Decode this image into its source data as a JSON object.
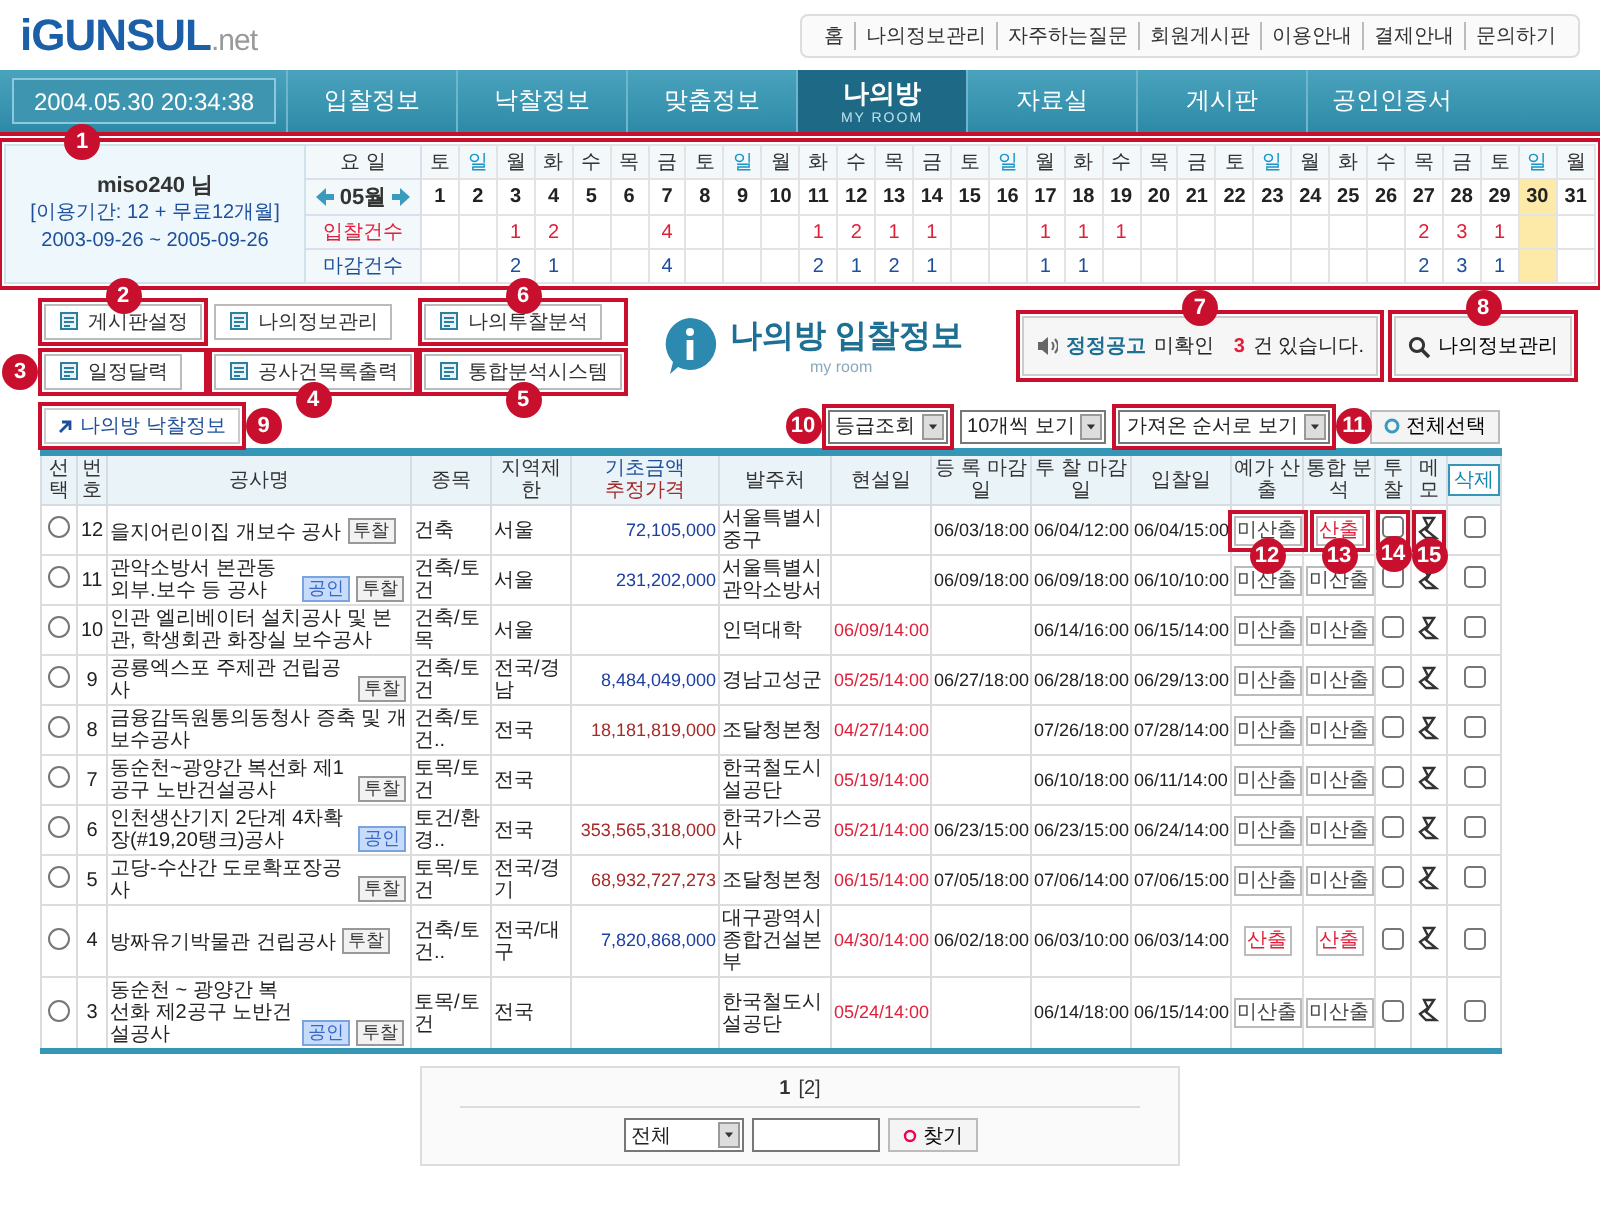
{
  "header": {
    "logo": {
      "main": "iGUNSUL",
      "suffix": ".net"
    },
    "top_links": [
      "홈",
      "나의정보관리",
      "자주하는질문",
      "회원게시판",
      "이용안내",
      "결제안내",
      "문의하기"
    ]
  },
  "nav": {
    "datetime": "2004.05.30 20:34:38",
    "items": [
      {
        "label": "입찰정보",
        "selected": false
      },
      {
        "label": "낙찰정보",
        "selected": false
      },
      {
        "label": "맞춤정보",
        "selected": false
      },
      {
        "label": "나의방",
        "sub": "MY ROOM",
        "selected": true
      },
      {
        "label": "자료실",
        "selected": false
      },
      {
        "label": "게시판",
        "selected": false
      },
      {
        "label": "공인인증서",
        "selected": false
      }
    ]
  },
  "calendar": {
    "callout": "1",
    "user": "miso240 님",
    "period": "[이용기간: 12 + 무료12개월]",
    "range": "2003-09-26 ~ 2005-09-26",
    "weekday_label": "요 일",
    "month": "05월",
    "bids_label": "입찰건수",
    "closes_label": "마감건수",
    "days": [
      {
        "weekday": "토",
        "date": "1",
        "holiday": false,
        "today": false
      },
      {
        "weekday": "일",
        "date": "2",
        "holiday": true,
        "today": false
      },
      {
        "weekday": "월",
        "date": "3",
        "bids": "1",
        "closes": "2",
        "holiday": false,
        "today": false
      },
      {
        "weekday": "화",
        "date": "4",
        "bids": "2",
        "closes": "1",
        "holiday": false,
        "today": false
      },
      {
        "weekday": "수",
        "date": "5",
        "holiday": false,
        "today": false
      },
      {
        "weekday": "목",
        "date": "6",
        "holiday": false,
        "today": false
      },
      {
        "weekday": "금",
        "date": "7",
        "bids": "4",
        "closes": "4",
        "holiday": false,
        "today": false
      },
      {
        "weekday": "토",
        "date": "8",
        "holiday": false,
        "today": false
      },
      {
        "weekday": "일",
        "date": "9",
        "holiday": true,
        "today": false
      },
      {
        "weekday": "월",
        "date": "10",
        "holiday": false,
        "today": false
      },
      {
        "weekday": "화",
        "date": "11",
        "bids": "1",
        "closes": "2",
        "holiday": false,
        "today": false
      },
      {
        "weekday": "수",
        "date": "12",
        "bids": "2",
        "closes": "1",
        "holiday": false,
        "today": false
      },
      {
        "weekday": "목",
        "date": "13",
        "bids": "1",
        "closes": "2",
        "holiday": false,
        "today": false
      },
      {
        "weekday": "금",
        "date": "14",
        "bids": "1",
        "closes": "1",
        "holiday": false,
        "today": false
      },
      {
        "weekday": "토",
        "date": "15",
        "holiday": false,
        "today": false
      },
      {
        "weekday": "일",
        "date": "16",
        "holiday": true,
        "today": false
      },
      {
        "weekday": "월",
        "date": "17",
        "bids": "1",
        "closes": "1",
        "holiday": false,
        "today": false
      },
      {
        "weekday": "화",
        "date": "18",
        "bids": "1",
        "closes": "1",
        "holiday": false,
        "today": false
      },
      {
        "weekday": "수",
        "date": "19",
        "bids": "1",
        "holiday": false,
        "today": false
      },
      {
        "weekday": "목",
        "date": "20",
        "holiday": false,
        "today": false
      },
      {
        "weekday": "금",
        "date": "21",
        "holiday": false,
        "today": false
      },
      {
        "weekday": "토",
        "date": "22",
        "holiday": false,
        "today": false
      },
      {
        "weekday": "일",
        "date": "23",
        "holiday": true,
        "today": false
      },
      {
        "weekday": "월",
        "date": "24",
        "holiday": false,
        "today": false
      },
      {
        "weekday": "화",
        "date": "25",
        "holiday": false,
        "today": false
      },
      {
        "weekday": "수",
        "date": "26",
        "holiday": false,
        "today": false
      },
      {
        "weekday": "목",
        "date": "27",
        "bids": "2",
        "closes": "2",
        "holiday": false,
        "today": false
      },
      {
        "weekday": "금",
        "date": "28",
        "bids": "3",
        "closes": "3",
        "holiday": false,
        "today": false
      },
      {
        "weekday": "토",
        "date": "29",
        "bids": "1",
        "closes": "1",
        "holiday": false,
        "today": false
      },
      {
        "weekday": "일",
        "date": "30",
        "holiday": true,
        "today": true
      },
      {
        "weekday": "월",
        "date": "31",
        "holiday": false,
        "today": false
      }
    ]
  },
  "menu_buttons": [
    {
      "label": "게시판설정",
      "callout": "2"
    },
    {
      "label": "나의정보관리"
    },
    {
      "label": "나의투찰분석",
      "callout": "6"
    },
    {
      "label": "일정달력",
      "callout": "3"
    },
    {
      "label": "공사건목록출력",
      "callout": "4"
    },
    {
      "label": "통합분석시스템",
      "callout": "5"
    }
  ],
  "title": {
    "text": "나의방 입찰정보",
    "sub": "my room"
  },
  "notice": {
    "callout": "7",
    "link": "정정공고",
    "text": "미확인",
    "count": "3",
    "suffix": "건 있습니다."
  },
  "info_button": {
    "label": "나의정보관리",
    "callout": "8"
  },
  "toolbar": {
    "won_link": {
      "label": "나의방 낙찰정보",
      "callout": "9"
    },
    "grade_select": {
      "value": "등급조회",
      "callout": "10"
    },
    "page_size_select": {
      "value": "10개씩 보기"
    },
    "sort_select": {
      "value": "가져온 순서로 보기",
      "callout": "11"
    },
    "select_all": {
      "label": "전체선택"
    }
  },
  "table": {
    "columns": [
      {
        "kind": "text",
        "label": "선택"
      },
      {
        "kind": "text",
        "label": "번호"
      },
      {
        "kind": "text",
        "label": "공사명"
      },
      {
        "kind": "text",
        "label": "종목"
      },
      {
        "kind": "text",
        "label": "지역제한"
      },
      {
        "kind": "amount",
        "label": "기초금액",
        "sub": "추정가격"
      },
      {
        "kind": "text",
        "label": "발주처"
      },
      {
        "kind": "text",
        "label": "현설일"
      },
      {
        "kind": "text",
        "label": "등 록 마감일"
      },
      {
        "kind": "text",
        "label": "투 찰 마감일"
      },
      {
        "kind": "text",
        "label": "입찰일"
      },
      {
        "kind": "text",
        "label": "예가 산출"
      },
      {
        "kind": "text",
        "label": "통합 분석"
      },
      {
        "kind": "text",
        "label": "투 찰"
      },
      {
        "kind": "text",
        "label": "메 모"
      },
      {
        "kind": "button",
        "label": "삭제"
      }
    ],
    "rows": [
      {
        "selected": false,
        "no": "12",
        "name": "을지어린이집 개보수 공사",
        "tags": [
          {
            "kind": "bid",
            "label": "투찰"
          }
        ],
        "category": "건축",
        "region": "서울",
        "amount": {
          "value": "72,105,000",
          "color": "#1d3fa0"
        },
        "agency": "서울특별시중구",
        "reg_deadline": "06/03/18:00",
        "bid_deadline": "06/04/12:00",
        "bid_date": "06/04/15:00",
        "estimate": {
          "label": "미산출",
          "calculated": false
        },
        "analysis": {
          "label": "산출",
          "calculated": true
        },
        "bid_checked": false,
        "delete_checked": false,
        "callouts": {
          "estimate": "12",
          "analysis": "13",
          "bid": "14",
          "memo": "15"
        }
      },
      {
        "selected": false,
        "no": "11",
        "name": "관악소방서 본관동 외부.보수 등 공사",
        "tags": [
          {
            "kind": "cert",
            "label": "공인"
          },
          {
            "kind": "bid",
            "label": "투찰"
          }
        ],
        "category": "건축/토건",
        "region": "서울",
        "amount": {
          "value": "231,202,000",
          "color": "#1d3fa0"
        },
        "agency": "서울특별시관악소방서",
        "reg_deadline": "06/09/18:00",
        "bid_deadline": "06/09/18:00",
        "bid_date": "06/10/10:00",
        "estimate": {
          "label": "미산출",
          "calculated": false
        },
        "analysis": {
          "label": "미산출",
          "calculated": false
        },
        "bid_checked": false,
        "delete_checked": false
      },
      {
        "selected": false,
        "no": "10",
        "name": "인관 엘리베이터 설치공사 및 본관, 학생회관 화장실 보수공사",
        "category": "건축/토목",
        "region": "서울",
        "agency": "인덕대학",
        "site_date": "06/09/14:00",
        "bid_deadline": "06/14/16:00",
        "bid_date": "06/15/14:00",
        "estimate": {
          "label": "미산출",
          "calculated": false
        },
        "analysis": {
          "label": "미산출",
          "calculated": false
        },
        "bid_checked": false,
        "delete_checked": false
      },
      {
        "selected": false,
        "no": "9",
        "name": "공룡엑스포 주제관 건립공사",
        "tags": [
          {
            "kind": "bid",
            "label": "투찰"
          }
        ],
        "category": "건축/토건",
        "region": "전국/경남",
        "amount": {
          "value": "8,484,049,000",
          "color": "#1d3fa0"
        },
        "agency": "경남고성군",
        "site_date": "05/25/14:00",
        "reg_deadline": "06/27/18:00",
        "bid_deadline": "06/28/18:00",
        "bid_date": "06/29/13:00",
        "estimate": {
          "label": "미산출",
          "calculated": false
        },
        "analysis": {
          "label": "미산출",
          "calculated": false
        },
        "bid_checked": false,
        "delete_checked": false
      },
      {
        "selected": false,
        "no": "8",
        "name": "금융감독원통의동청사 증축 및 개보수공사",
        "category": "건축/토건..",
        "region": "전국",
        "amount": {
          "value": "18,181,819,000",
          "color": "#a52a2a"
        },
        "agency": "조달청본청",
        "site_date": "04/27/14:00",
        "bid_deadline": "07/26/18:00",
        "bid_date": "07/28/14:00",
        "estimate": {
          "label": "미산출",
          "calculated": false
        },
        "analysis": {
          "label": "미산출",
          "calculated": false
        },
        "bid_checked": false,
        "delete_checked": false
      },
      {
        "selected": false,
        "no": "7",
        "name": "동순천~광양간 복선화 제1공구 노반건설공사",
        "tags": [
          {
            "kind": "bid",
            "label": "투찰"
          }
        ],
        "category": "토목/토건",
        "region": "전국",
        "agency": "한국철도시설공단",
        "site_date": "05/19/14:00",
        "bid_deadline": "06/10/18:00",
        "bid_date": "06/11/14:00",
        "estimate": {
          "label": "미산출",
          "calculated": false
        },
        "analysis": {
          "label": "미산출",
          "calculated": false
        },
        "bid_checked": false,
        "delete_checked": false
      },
      {
        "selected": false,
        "no": "6",
        "name": "인천생산기지 2단계 4차확장(#19,20탱크)공사",
        "tags": [
          {
            "kind": "cert",
            "label": "공인"
          }
        ],
        "category": "토건/환경..",
        "region": "전국",
        "amount": {
          "value": "353,565,318,000",
          "color": "#a52a2a"
        },
        "agency": "한국가스공사",
        "site_date": "05/21/14:00",
        "reg_deadline": "06/23/15:00",
        "bid_deadline": "06/23/15:00",
        "bid_date": "06/24/14:00",
        "estimate": {
          "label": "미산출",
          "calculated": false
        },
        "analysis": {
          "label": "미산출",
          "calculated": false
        },
        "bid_checked": false,
        "delete_checked": false
      },
      {
        "selected": false,
        "no": "5",
        "name": "고당-수산간 도로확포장공사",
        "tags": [
          {
            "kind": "bid",
            "label": "투찰"
          }
        ],
        "category": "토목/토건",
        "region": "전국/경기",
        "amount": {
          "value": "68,932,727,273",
          "color": "#a52a2a"
        },
        "agency": "조달청본청",
        "site_date": "06/15/14:00",
        "reg_deadline": "07/05/18:00",
        "bid_deadline": "07/06/14:00",
        "bid_date": "07/06/15:00",
        "estimate": {
          "label": "미산출",
          "calculated": false
        },
        "analysis": {
          "label": "미산출",
          "calculated": false
        },
        "bid_checked": false,
        "delete_checked": false
      },
      {
        "selected": false,
        "no": "4",
        "name": "방짜유기박물관 건립공사",
        "tags": [
          {
            "kind": "bid",
            "label": "투찰"
          }
        ],
        "category": "건축/토건..",
        "region": "전국/대구",
        "amount": {
          "value": "7,820,868,000",
          "color": "#1d3fa0"
        },
        "agency": "대구광역시종합건설본부",
        "site_date": "04/30/14:00",
        "reg_deadline": "06/02/18:00",
        "bid_deadline": "06/03/10:00",
        "bid_date": "06/03/14:00",
        "estimate": {
          "label": "산출",
          "calculated": true
        },
        "analysis": {
          "label": "산출",
          "calculated": true
        },
        "bid_checked": false,
        "delete_checked": false
      },
      {
        "selected": false,
        "no": "3",
        "name": "동순천 ~ 광양간 복선화 제2공구 노반건설공사",
        "tags": [
          {
            "kind": "cert",
            "label": "공인"
          },
          {
            "kind": "bid",
            "label": "투찰"
          }
        ],
        "category": "토목/토건",
        "region": "전국",
        "agency": "한국철도시설공단",
        "site_date": "05/24/14:00",
        "bid_deadline": "06/14/18:00",
        "bid_date": "06/15/14:00",
        "estimate": {
          "label": "미산출",
          "calculated": false
        },
        "analysis": {
          "label": "미산출",
          "calculated": false
        },
        "bid_checked": false,
        "delete_checked": false
      }
    ]
  },
  "pagination": {
    "pages": [
      {
        "label": "1",
        "selected": true
      },
      {
        "label": "[2]",
        "selected": false
      }
    ],
    "filter": "전체",
    "search_button": "찾기"
  }
}
